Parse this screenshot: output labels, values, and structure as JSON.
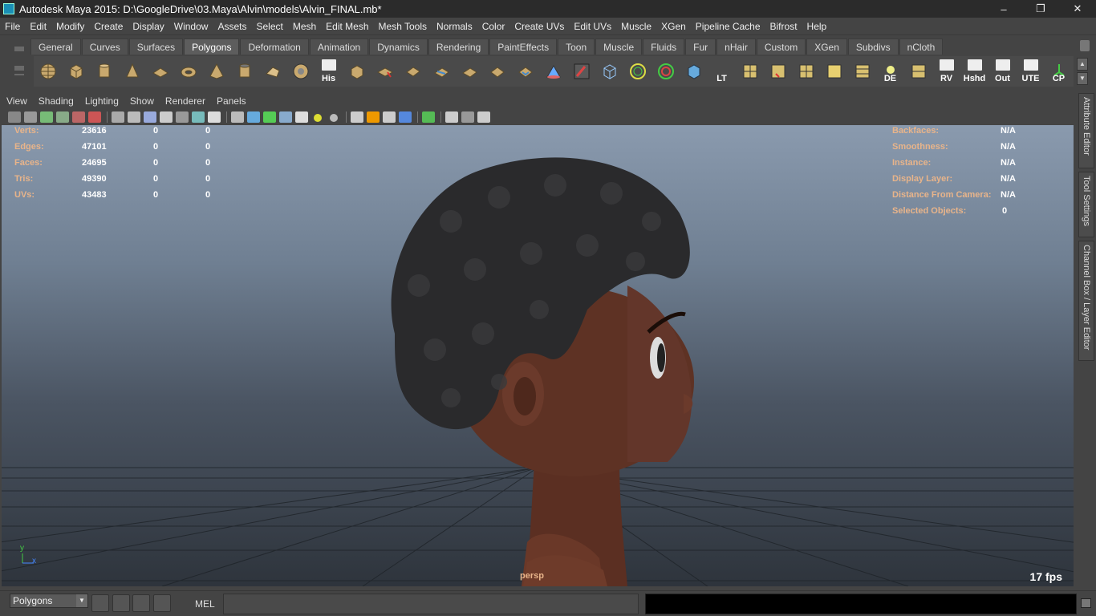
{
  "window": {
    "title": "Autodesk Maya 2015: D:\\GoogleDrive\\03.Maya\\Alvin\\models\\Alvin_FINAL.mb*",
    "controls": [
      "–",
      "❐",
      "✕"
    ]
  },
  "menubar": [
    "File",
    "Edit",
    "Modify",
    "Create",
    "Display",
    "Window",
    "Assets",
    "Select",
    "Mesh",
    "Edit Mesh",
    "Mesh Tools",
    "Normals",
    "Color",
    "Create UVs",
    "Edit UVs",
    "Muscle",
    "XGen",
    "Pipeline Cache",
    "Bifrost",
    "Help"
  ],
  "shelf": {
    "tabs": [
      "General",
      "Curves",
      "Surfaces",
      "Polygons",
      "Deformation",
      "Animation",
      "Dynamics",
      "Rendering",
      "PaintEffects",
      "Toon",
      "Muscle",
      "Fluids",
      "Fur",
      "nHair",
      "Custom",
      "XGen",
      "Subdivs",
      "nCloth"
    ],
    "active_tab": "Polygons",
    "icon_labels": {
      "his": "His",
      "lt": "LT",
      "de": "DE",
      "rv": "RV",
      "hshd": "Hshd",
      "out": "Out",
      "ute": "UTE",
      "cp": "CP"
    }
  },
  "panel": {
    "menu": [
      "View",
      "Shading",
      "Lighting",
      "Show",
      "Renderer",
      "Panels"
    ]
  },
  "hud": {
    "left": [
      {
        "label": "Verts:",
        "v1": "23616",
        "v2": "0",
        "v3": "0"
      },
      {
        "label": "Edges:",
        "v1": "47101",
        "v2": "0",
        "v3": "0"
      },
      {
        "label": "Faces:",
        "v1": "24695",
        "v2": "0",
        "v3": "0"
      },
      {
        "label": "Tris:",
        "v1": "49390",
        "v2": "0",
        "v3": "0"
      },
      {
        "label": "UVs:",
        "v1": "43483",
        "v2": "0",
        "v3": "0"
      }
    ],
    "right": [
      {
        "label": "Backfaces:",
        "value": "N/A"
      },
      {
        "label": "Smoothness:",
        "value": "N/A"
      },
      {
        "label": "Instance:",
        "value": "N/A"
      },
      {
        "label": "Display Layer:",
        "value": "N/A"
      },
      {
        "label": "Distance From Camera:",
        "value": "N/A"
      },
      {
        "label": "Selected Objects:",
        "value": "0"
      }
    ],
    "camera": "persp",
    "fps": "17 fps",
    "axis_y": "y",
    "axis_x": "x"
  },
  "sidetabs": [
    "Attribute Editor",
    "Tool Settings",
    "Channel Box / Layer Editor"
  ],
  "commandline": {
    "mode": "Polygons",
    "mel_label": "MEL",
    "input_value": ""
  }
}
